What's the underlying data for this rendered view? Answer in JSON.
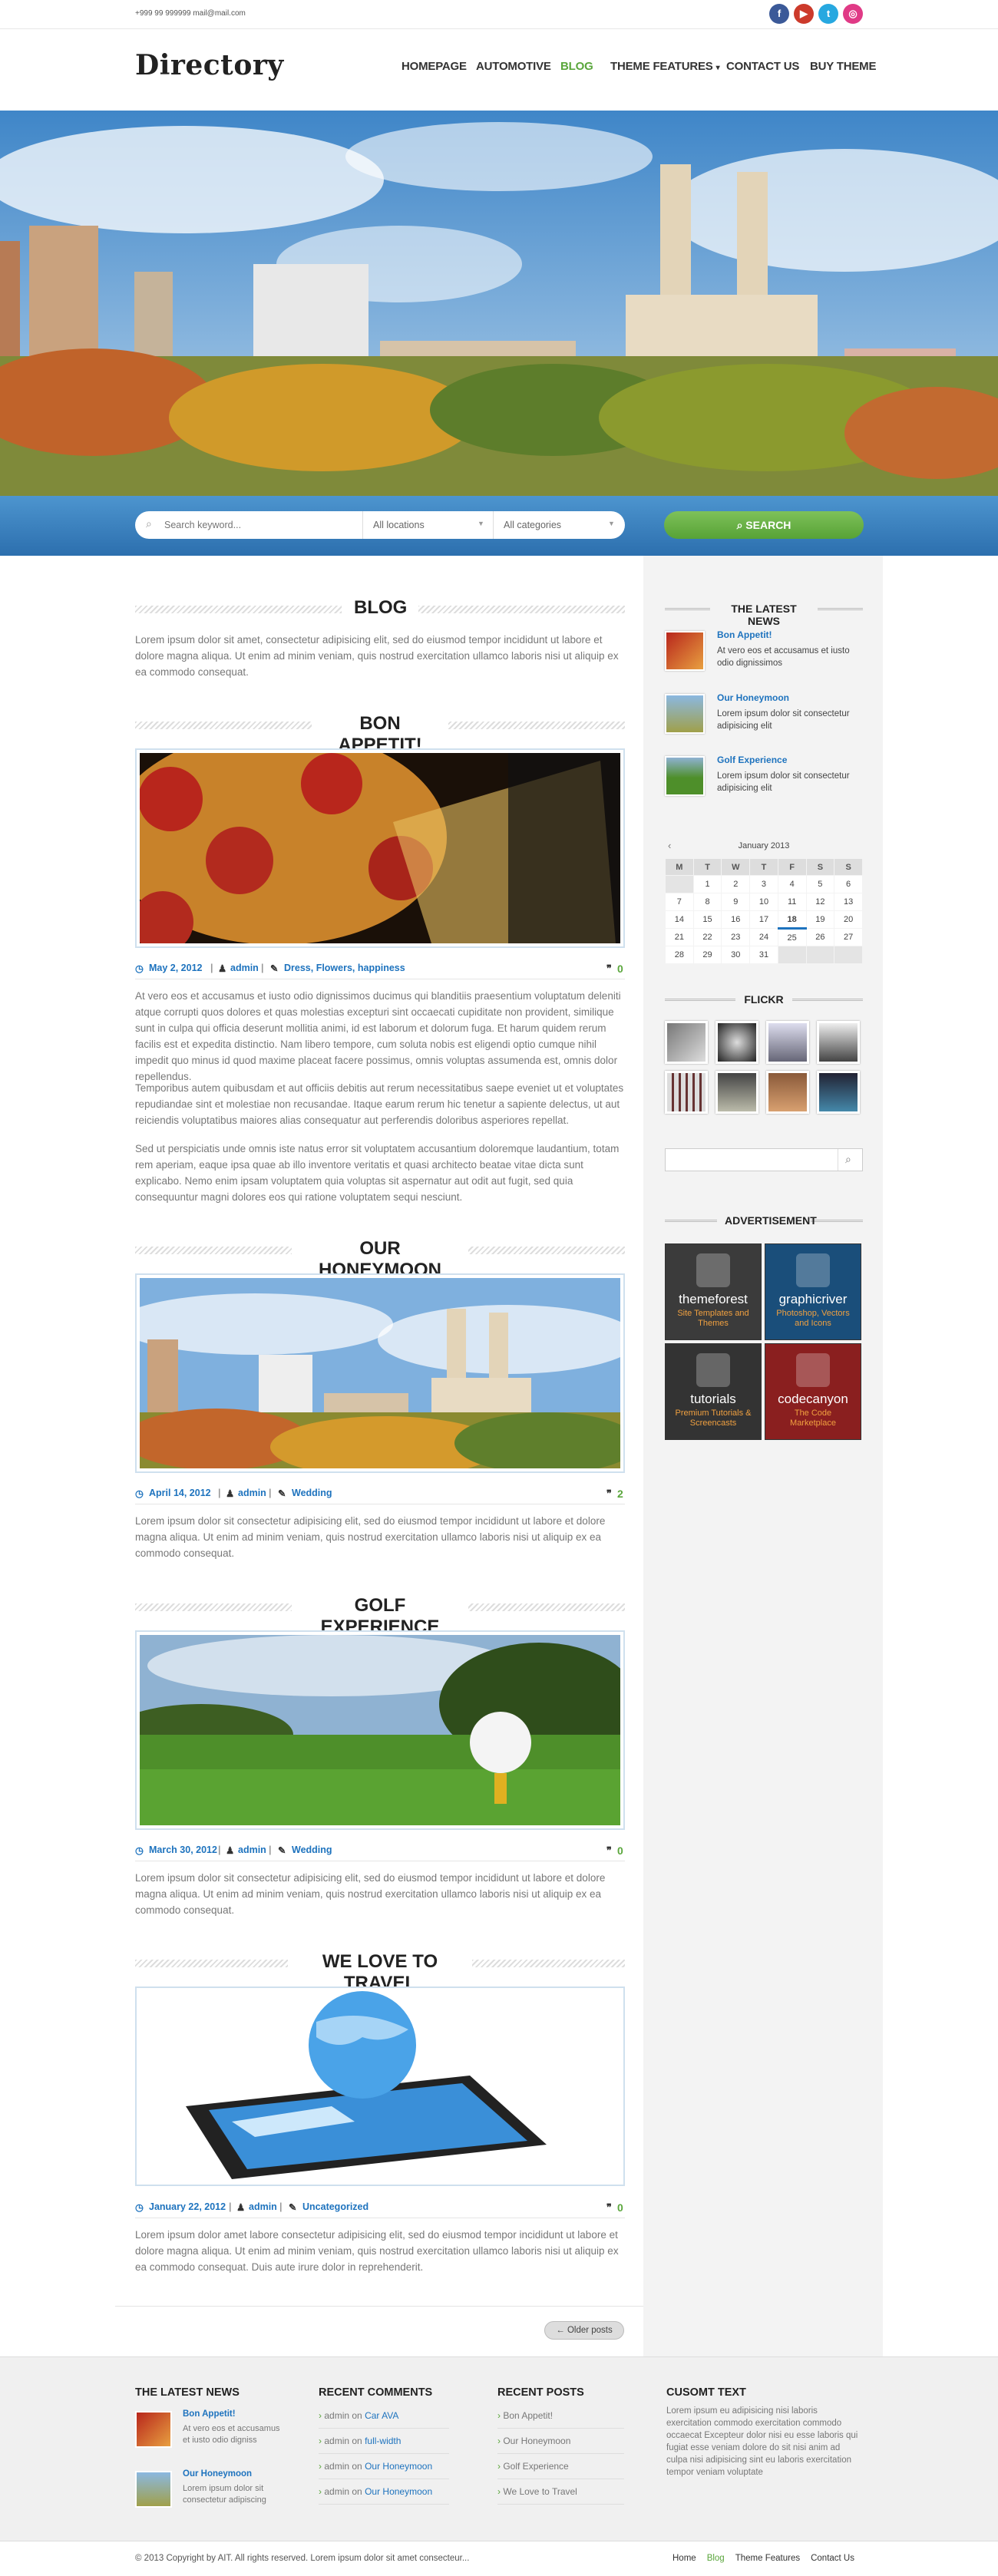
{
  "topbar": {
    "contact": "+999 99 999999 mail@mail.com"
  },
  "header": {
    "logo": "Directory",
    "nav": [
      "HOMEPAGE",
      "AUTOMOTIVE",
      "BLOG",
      "THEME FEATURES",
      "CONTACT US",
      "BUY THEME"
    ],
    "active": "BLOG"
  },
  "search": {
    "keyword_placeholder": "Search keyword...",
    "location_value": "All locations",
    "category_value": "All categories",
    "button_label": "SEARCH"
  },
  "blog": {
    "title": "BLOG",
    "intro": "Lorem ipsum dolor sit amet, consectetur adipisicing elit, sed do eiusmod tempor incididunt ut labore et dolore magna aliqua. Ut enim ad minim veniam, quis nostrud exercitation ullamco laboris nisi ut aliquip ex ea commodo consequat.",
    "posts": [
      {
        "title": "BON APPETIT!",
        "date": "May 2, 2012",
        "author": "admin",
        "tags": "Dress, Flowers, happiness",
        "comments": "0",
        "paragraphs": [
          "At vero eos et accusamus et iusto odio dignissimos ducimus qui blanditiis praesentium voluptatum deleniti atque corrupti quos dolores et quas molestias excepturi sint occaecati cupiditate non provident, similique sunt in culpa qui officia deserunt mollitia animi, id est laborum et dolorum fuga. Et harum quidem rerum facilis est et expedita distinctio. Nam libero tempore, cum soluta nobis est eligendi optio cumque nihil impedit quo minus id quod maxime placeat facere possimus, omnis voluptas assumenda est, omnis dolor repellendus.",
          "Temporibus autem quibusdam et aut officiis debitis aut rerum necessitatibus saepe eveniet ut et voluptates repudiandae sint et molestiae non recusandae. Itaque earum rerum hic tenetur a sapiente delectus, ut aut reiciendis voluptatibus maiores alias consequatur aut perferendis doloribus asperiores repellat.",
          "Sed ut perspiciatis unde omnis iste natus error sit voluptatem accusantium doloremque laudantium, totam rem aperiam, eaque ipsa quae ab illo inventore veritatis et quasi architecto beatae vitae dicta sunt explicabo. Nemo enim ipsam voluptatem quia voluptas sit aspernatur aut odit aut fugit, sed quia consequuntur magni dolores eos qui ratione voluptatem sequi nesciunt."
        ]
      },
      {
        "title": "OUR HONEYMOON",
        "date": "April 14, 2012",
        "author": "admin",
        "tags": "Wedding",
        "comments": "2",
        "paragraphs": [
          "Lorem ipsum dolor sit consectetur adipisicing elit, sed do eiusmod tempor incididunt ut labore et dolore magna aliqua. Ut enim ad minim veniam, quis nostrud exercitation ullamco laboris nisi ut aliquip ex ea commodo consequat."
        ]
      },
      {
        "title": "GOLF EXPERIENCE",
        "date": "March 30, 2012",
        "author": "admin",
        "tags": "Wedding",
        "comments": "0",
        "paragraphs": [
          "Lorem ipsum dolor sit consectetur adipisicing elit, sed do eiusmod tempor incididunt ut labore et dolore magna aliqua. Ut enim ad minim veniam, quis nostrud exercitation ullamco laboris nisi ut aliquip ex ea commodo consequat."
        ]
      },
      {
        "title": "WE LOVE TO TRAVEL",
        "date": "January 22, 2012",
        "author": "admin",
        "tags": "Uncategorized",
        "comments": "0",
        "paragraphs": [
          "Lorem ipsum dolor amet labore consectetur adipisicing elit, sed do eiusmod tempor incididunt ut labore et dolore magna aliqua. Ut enim ad minim veniam, quis nostrud exercitation ullamco laboris nisi ut aliquip ex ea commodo consequat. Duis aute irure dolor in reprehenderit."
        ]
      }
    ],
    "older_posts": "← Older posts"
  },
  "sidebar": {
    "latest_news_title": "THE LATEST NEWS",
    "news": [
      {
        "title": "Bon Appetit!",
        "excerpt": "At vero eos et accusamus et iusto odio dignissimos"
      },
      {
        "title": "Our Honeymoon",
        "excerpt": "Lorem ipsum dolor sit consectetur adipisicing elit"
      },
      {
        "title": "Golf Experience",
        "excerpt": "Lorem ipsum dolor sit consectetur adipisicing elit"
      }
    ],
    "calendar": {
      "month": "January 2013",
      "days": [
        "M",
        "T",
        "W",
        "T",
        "F",
        "S",
        "S"
      ],
      "weeks": [
        [
          "",
          "1",
          "2",
          "3",
          "4",
          "5",
          "6"
        ],
        [
          "7",
          "8",
          "9",
          "10",
          "11",
          "12",
          "13"
        ],
        [
          "14",
          "15",
          "16",
          "17",
          "18",
          "19",
          "20"
        ],
        [
          "21",
          "22",
          "23",
          "24",
          "25",
          "26",
          "27"
        ],
        [
          "28",
          "29",
          "30",
          "31",
          "",
          "",
          ""
        ]
      ],
      "today": "18"
    },
    "flickr_title": "FLICKR",
    "ads_title": "ADVERTISEMENT",
    "ads": [
      {
        "name": "themeforest",
        "sub": "Site Templates and Themes",
        "color": "#3b3b3b"
      },
      {
        "name": "graphicriver",
        "sub": "Photoshop, Vectors and Icons",
        "color": "#1a4e7a"
      },
      {
        "name": "tutorials",
        "sub": "Premium Tutorials & Screencasts",
        "color": "#333333"
      },
      {
        "name": "codecanyon",
        "sub": "The Code Marketplace",
        "color": "#8a1f1f"
      }
    ]
  },
  "footer": {
    "latest_news_title": "THE LATEST NEWS",
    "news": [
      {
        "title": "Bon Appetit!",
        "excerpt": "At vero eos et accusamus et iusto odio digniss"
      },
      {
        "title": "Our Honeymoon",
        "excerpt": "Lorem ipsum dolor sit consectetur adipiscing"
      }
    ],
    "recent_comments_title": "RECENT COMMENTS",
    "comments": [
      {
        "author": "admin",
        "on": "on",
        "post": "Car AVA"
      },
      {
        "author": "admin",
        "on": "on",
        "post": "full-width"
      },
      {
        "author": "admin",
        "on": "on",
        "post": "Our Honeymoon"
      },
      {
        "author": "admin",
        "on": "on",
        "post": "Our Honeymoon"
      }
    ],
    "recent_posts_title": "RECENT POSTS",
    "posts": [
      "Bon Appetit!",
      "Our Honeymoon",
      "Golf Experience",
      "We Love to Travel"
    ],
    "custom_title": "CUSOMT TEXT",
    "custom_text": "Lorem ipsum eu adipisicing nisi laboris exercitation commodo exercitation commodo occaecat Excepteur dolor nisi eu esse laboris qui fugiat esse veniam dolore do sit nisi anim ad culpa nisi adipisicing sint eu laboris exercitation tempor veniam voluptate",
    "copyright": "© 2013 Copyright by AIT. All rights reserved. Lorem ipsum dolor sit amet consecteur...",
    "links": [
      "Home",
      "Blog",
      "Theme Features",
      "Contact Us"
    ],
    "active_link": "Blog"
  }
}
